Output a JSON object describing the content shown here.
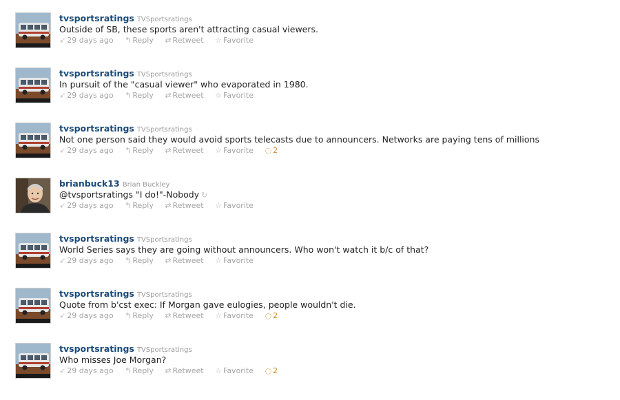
{
  "tweets": [
    {
      "screen_name": "tvsportsratings",
      "full_name": "TVSportsratings",
      "text": "Outside of SB, these sports aren't attracting casual viewers.",
      "timestamp": "29 days ago",
      "reply_label": "Reply",
      "retweet_label": "Retweet",
      "favorite_label": "Favorite",
      "replies": "",
      "avatar_icon": "bus-icon"
    },
    {
      "screen_name": "tvsportsratings",
      "full_name": "TVSportsratings",
      "text": "In pursuit of the \"casual viewer\" who evaporated in 1980.",
      "timestamp": "29 days ago",
      "reply_label": "Reply",
      "retweet_label": "Retweet",
      "favorite_label": "Favorite",
      "replies": "",
      "avatar_icon": "bus-icon"
    },
    {
      "screen_name": "tvsportsratings",
      "full_name": "TVSportsratings",
      "text": "Not one person said they would avoid sports telecasts due to announcers. Networks are paying tens of millions",
      "timestamp": "29 days ago",
      "reply_label": "Reply",
      "retweet_label": "Retweet",
      "favorite_label": "Favorite",
      "replies": "2",
      "avatar_icon": "bus-icon"
    },
    {
      "screen_name": "brianbuck13",
      "full_name": "Brian Buckley",
      "text": "@tvsportsratings \"I do!\"-Nobody",
      "timestamp": "29 days ago",
      "reply_label": "Reply",
      "retweet_label": "Retweet",
      "favorite_label": "Favorite",
      "replies": "",
      "avatar_icon": "person-photo-icon"
    },
    {
      "screen_name": "tvsportsratings",
      "full_name": "TVSportsratings",
      "text": "World Series says they are going without announcers. Who won't watch it b/c of that?",
      "timestamp": "29 days ago",
      "reply_label": "Reply",
      "retweet_label": "Retweet",
      "favorite_label": "Favorite",
      "replies": "",
      "avatar_icon": "bus-icon"
    },
    {
      "screen_name": "tvsportsratings",
      "full_name": "TVSportsratings",
      "text": "Quote from b'cst exec: If Morgan gave eulogies, people wouldn't die.",
      "timestamp": "29 days ago",
      "reply_label": "Reply",
      "retweet_label": "Retweet",
      "favorite_label": "Favorite",
      "replies": "2",
      "avatar_icon": "bus-icon"
    },
    {
      "screen_name": "tvsportsratings",
      "full_name": "TVSportsratings",
      "text": "Who misses Joe Morgan?",
      "timestamp": "29 days ago",
      "reply_label": "Reply",
      "retweet_label": "Retweet",
      "favorite_label": "Favorite",
      "replies": "2",
      "avatar_icon": "bus-icon"
    }
  ],
  "colors": {
    "screen_name": "#1a4a78",
    "reply_count": "#d08a2c",
    "meta": "#a4a4a4"
  }
}
